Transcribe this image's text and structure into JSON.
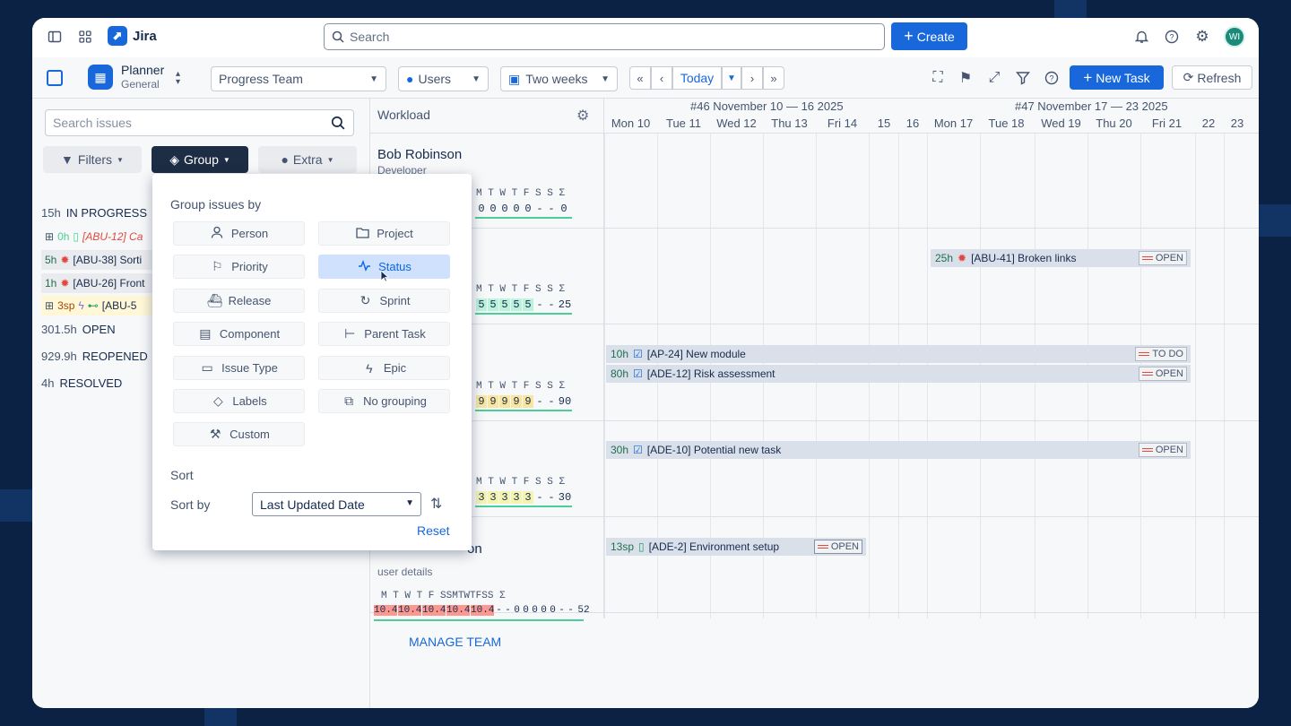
{
  "app": {
    "name": "Jira",
    "avatar_initials": "WI"
  },
  "topbar": {
    "search_placeholder": "Search",
    "create_label": "Create"
  },
  "toolbar": {
    "planner_title": "Planner",
    "planner_subtitle": "General",
    "team_select": "Progress Team",
    "users_select": "Users",
    "range_select": "Two weeks",
    "today_label": "Today",
    "new_task_label": "New Task",
    "refresh_label": "Refresh"
  },
  "left": {
    "search_placeholder": "Search issues",
    "filters_label": "Filters",
    "group_label": "Group",
    "extra_label": "Extra",
    "groups": [
      {
        "hours": "15h",
        "name": "IN PROGRESS"
      },
      {
        "hours": "301.5h",
        "name": "OPEN"
      },
      {
        "hours": "929.9h",
        "name": "REOPENED"
      },
      {
        "hours": "4h",
        "name": "RESOLVED"
      }
    ],
    "issues": [
      {
        "hours": "0h",
        "text": "[ABU-12] Ca"
      },
      {
        "hours": "5h",
        "text": "[ABU-38] Sorti"
      },
      {
        "hours": "1h",
        "text": "[ABU-26] Front"
      },
      {
        "hours": "3sp",
        "text": "[ABU-5"
      }
    ]
  },
  "workload": {
    "title": "Workload",
    "weeks": [
      "#46 November 10 — 16 2025",
      "#47 November 17 — 23 2025"
    ],
    "days": [
      "Mon 10",
      "Tue 11",
      "Wed 12",
      "Thu 13",
      "Fri 14",
      "15",
      "16",
      "Mon 17",
      "Tue 18",
      "Wed 19",
      "Thu 20",
      "Fri 21",
      "22",
      "23"
    ],
    "people": [
      {
        "name": "Bob Robinson",
        "role": "Developer",
        "week_letters": "M T W T F S S Σ",
        "values": [
          "0",
          "0",
          "0",
          "0",
          "0",
          "-",
          "-",
          "0"
        ]
      },
      {
        "week_letters": "M T W T F S S Σ",
        "values": [
          "5",
          "5",
          "5",
          "5",
          "5",
          "-",
          "-",
          "25"
        ]
      },
      {
        "week_letters": "M T W T F S S Σ",
        "values": [
          "9",
          "9",
          "9",
          "9",
          "9",
          "-",
          "-",
          "90"
        ]
      },
      {
        "week_letters": "M T W T F S S Σ",
        "values": [
          "3",
          "3",
          "3",
          "3",
          "3",
          "-",
          "-",
          "30"
        ]
      },
      {
        "name": "on",
        "role": "user details",
        "week_letters": "M T W T F SSMTWTFSS Σ",
        "values": [
          "10.4",
          "10.4",
          "10.4",
          "10.4",
          "10.4",
          "-",
          "-",
          "0",
          "0",
          "0",
          "0",
          "0",
          "-",
          "-",
          "52"
        ]
      }
    ],
    "manage_team": "MANAGE TEAM"
  },
  "tasks": [
    {
      "hours": "25h",
      "text": "[ABU-41] Broken links",
      "status": "OPEN"
    },
    {
      "hours": "10h",
      "text": "[AP-24] New module",
      "status": "TO DO"
    },
    {
      "hours": "80h",
      "text": "[ADE-12] Risk assessment",
      "status": "OPEN"
    },
    {
      "hours": "30h",
      "text": "[ADE-10] Potential new task",
      "status": "OPEN"
    },
    {
      "hours": "13sp",
      "text": "[ADE-2] Environment setup",
      "status": "OPEN"
    }
  ],
  "popup": {
    "heading": "Group issues by",
    "options": [
      "Person",
      "Project",
      "Priority",
      "Status",
      "Release",
      "Sprint",
      "Component",
      "Parent Task",
      "Issue Type",
      "Epic",
      "Labels",
      "No grouping",
      "Custom"
    ],
    "selected": "Status",
    "sort_heading": "Sort",
    "sort_by_label": "Sort by",
    "sort_value": "Last Updated Date",
    "reset_label": "Reset"
  }
}
